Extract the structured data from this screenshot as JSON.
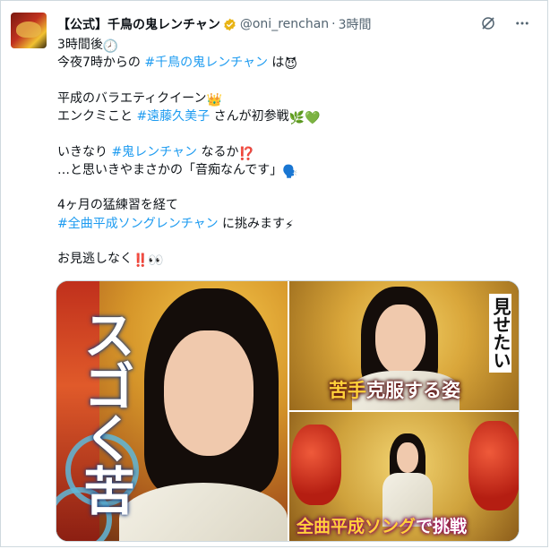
{
  "post": {
    "display_name": "【公式】千鳥の鬼レンチャン",
    "handle": "@oni_renchan",
    "separator": "·",
    "time": "3時間",
    "lines": [
      {
        "parts": [
          {
            "t": "3時間後",
            "c": "text"
          },
          {
            "t": "🕗",
            "c": "emoji"
          }
        ]
      },
      {
        "parts": [
          {
            "t": "今夜7時からの ",
            "c": "text"
          },
          {
            "t": "#千鳥の鬼レンチャン",
            "c": "tag"
          },
          {
            "t": " は",
            "c": "text"
          },
          {
            "t": "😈",
            "c": "emoji"
          }
        ]
      },
      {
        "blank": true
      },
      {
        "parts": [
          {
            "t": "平成のバラエティクイーン",
            "c": "text"
          },
          {
            "t": "👑",
            "c": "emoji"
          }
        ]
      },
      {
        "parts": [
          {
            "t": "エンクミこと ",
            "c": "text"
          },
          {
            "t": "#遠藤久美子",
            "c": "tag"
          },
          {
            "t": " さんが初参戦",
            "c": "text"
          },
          {
            "t": "🌿💚",
            "c": "emoji"
          }
        ]
      },
      {
        "blank": true
      },
      {
        "parts": [
          {
            "t": "いきなり ",
            "c": "text"
          },
          {
            "t": "#鬼レンチャン",
            "c": "tag"
          },
          {
            "t": " なるか",
            "c": "text"
          },
          {
            "t": "⁉️",
            "c": "emoji"
          }
        ]
      },
      {
        "parts": [
          {
            "t": "…と思いきやまさかの「音痴なんです」",
            "c": "text"
          },
          {
            "t": "🗣️",
            "c": "emoji"
          }
        ]
      },
      {
        "blank": true
      },
      {
        "parts": [
          {
            "t": "4ヶ月の猛練習を経て",
            "c": "text"
          }
        ]
      },
      {
        "parts": [
          {
            "t": "#全曲平成ソングレンチャン",
            "c": "tag"
          },
          {
            "t": " に挑みます",
            "c": "text"
          },
          {
            "t": "⚡",
            "c": "emoji"
          }
        ]
      },
      {
        "blank": true
      },
      {
        "parts": [
          {
            "t": "お見逃しなく",
            "c": "text"
          },
          {
            "t": "‼️👀",
            "c": "emoji"
          }
        ]
      }
    ]
  },
  "media": {
    "left_caption": "スゴく苦",
    "top_right_vertical": "見せたい",
    "top_right_caption_hi": "苦手",
    "top_right_caption": "克服する姿",
    "bottom_right_caption_hi": "全曲平成ソング",
    "bottom_right_caption": "で挑戦"
  },
  "icons": [
    "verified-badge-icon",
    "grok-icon",
    "more-icon"
  ],
  "colors": {
    "link": "#1d9bf0",
    "verified": "#e8b416",
    "secondary": "#536471"
  }
}
